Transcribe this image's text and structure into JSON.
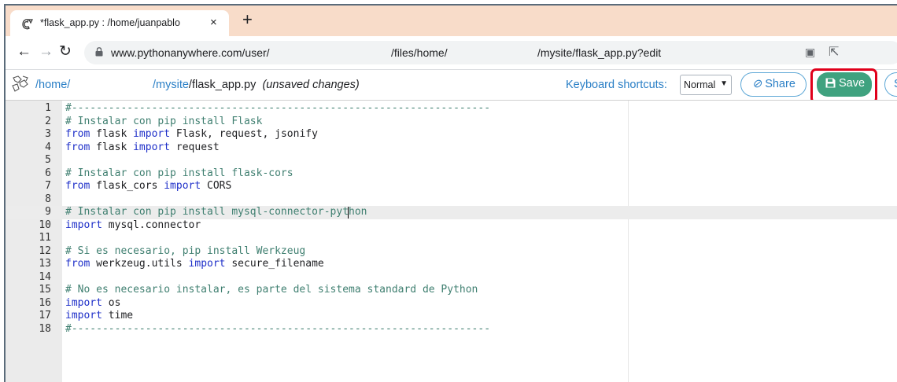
{
  "browser": {
    "tab_title": "*flask_app.py : /home/juanpablo",
    "tab_close": "×",
    "new_tab": "+",
    "url_parts": [
      "www.pythonanywhere.com/user/",
      "/files/home/",
      "/mysite/flask_app.py?edit"
    ]
  },
  "editor_header": {
    "path_home": "/home/",
    "path_mysite": "/mysite",
    "path_file": "/flask_app.py",
    "unsaved": "(unsaved changes)",
    "kb_label": "Keyboard shortcuts:",
    "kb_value": "Normal",
    "share_label": "Share",
    "save_label": "Save",
    "edge_label": "S"
  },
  "code": {
    "lines": [
      "#--------------------------------------------------------------------",
      "# Instalar con pip install Flask",
      "from flask import Flask, request, jsonify",
      "from flask import request",
      "",
      "# Instalar con pip install flask-cors",
      "from flask_cors import CORS",
      "",
      "# Instalar con pip install mysql-connector-python",
      "import mysql.connector",
      "",
      "# Si es necesario, pip install Werkzeug",
      "from werkzeug.utils import secure_filename",
      "",
      "# No es necesario instalar, es parte del sistema standard de Python",
      "import os",
      "import time",
      "#--------------------------------------------------------------------"
    ],
    "active_line": 9
  },
  "colors": {
    "save_green": "#3fa27f",
    "highlight_red": "#e0001b",
    "link_blue": "#2a7fc6",
    "tabstrip": "#f8dcc9"
  }
}
